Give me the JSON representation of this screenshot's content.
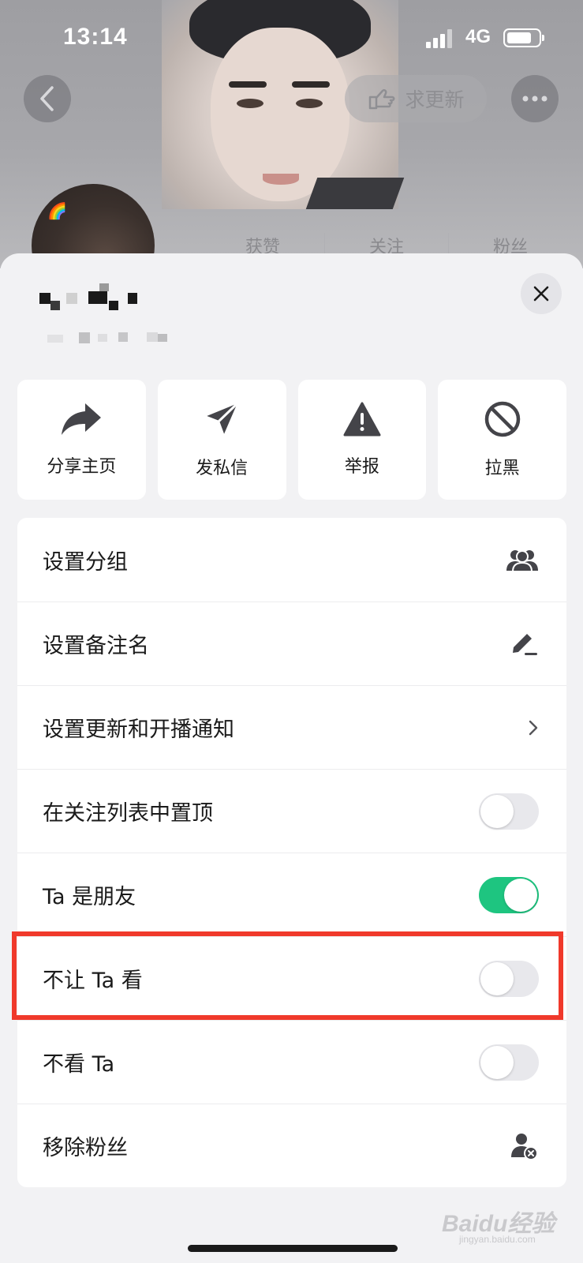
{
  "status_bar": {
    "time": "13:14",
    "network": "4G"
  },
  "header": {
    "update_label": "求更新",
    "stats": [
      {
        "label": "获赞"
      },
      {
        "label": "关注"
      },
      {
        "label": "粉丝"
      }
    ]
  },
  "actions": [
    {
      "label": "分享主页",
      "icon": "share-icon"
    },
    {
      "label": "发私信",
      "icon": "send-icon"
    },
    {
      "label": "举报",
      "icon": "warning-icon"
    },
    {
      "label": "拉黑",
      "icon": "block-icon"
    }
  ],
  "menu": [
    {
      "label": "设置分组",
      "control": "group-icon"
    },
    {
      "label": "设置备注名",
      "control": "edit-icon"
    },
    {
      "label": "设置更新和开播通知",
      "control": "chevron-right-icon"
    },
    {
      "label": "在关注列表中置顶",
      "control": "toggle",
      "on": false
    },
    {
      "label": "Ta 是朋友",
      "control": "toggle",
      "on": true
    },
    {
      "label": "不让 Ta 看",
      "control": "toggle",
      "on": false
    },
    {
      "label": "不看 Ta",
      "control": "toggle",
      "on": false
    },
    {
      "label": "移除粉丝",
      "control": "remove-user-icon"
    }
  ],
  "colors": {
    "toggle_on": "#1ec580",
    "highlight": "#f0392b"
  },
  "watermark": {
    "brand": "Baidu经验",
    "url": "jingyan.baidu.com"
  }
}
